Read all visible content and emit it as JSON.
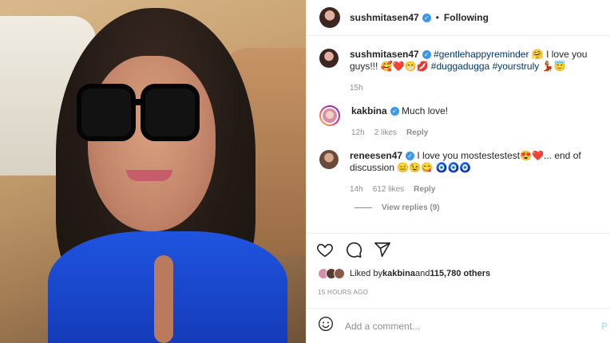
{
  "post": {
    "author": "sushmitasen47",
    "follow_separator": "•",
    "follow_status": "Following"
  },
  "caption": {
    "username": "sushmitasen47",
    "hashtag1": "#gentlehappyreminder",
    "text1": " 🤗 I love you guys!!! 🥰❤️😁💋 ",
    "hashtag2": "#duggadugga",
    "hashtag3": "#yourstruly",
    "text2": " 💃😇",
    "time": "15h"
  },
  "comments": [
    {
      "username": "kakbina",
      "text": "Much love!",
      "time": "12h",
      "likes": "2 likes",
      "reply": "Reply"
    },
    {
      "username": "reneesen47",
      "text": "I love you mostestestest😍❤️... end of discussion 😑😉😋 🧿🧿🧿",
      "time": "14h",
      "likes": "612 likes",
      "reply": "Reply",
      "view_replies": "View replies (9)"
    }
  ],
  "likes_bar": {
    "prefix": "Liked by ",
    "user": "kakbina",
    "middle": " and ",
    "others": "115,780 others"
  },
  "timestamp": "15 HOURS AGO",
  "composer": {
    "placeholder": "Add a comment...",
    "post_label": "P"
  },
  "icons": {
    "like": "heart-icon",
    "comment": "comment-icon",
    "share": "send-icon",
    "emoji": "emoji-icon"
  },
  "colors": {
    "verified": "#3897f0",
    "hashtag": "#00376b",
    "muted": "#8e8e8e"
  }
}
